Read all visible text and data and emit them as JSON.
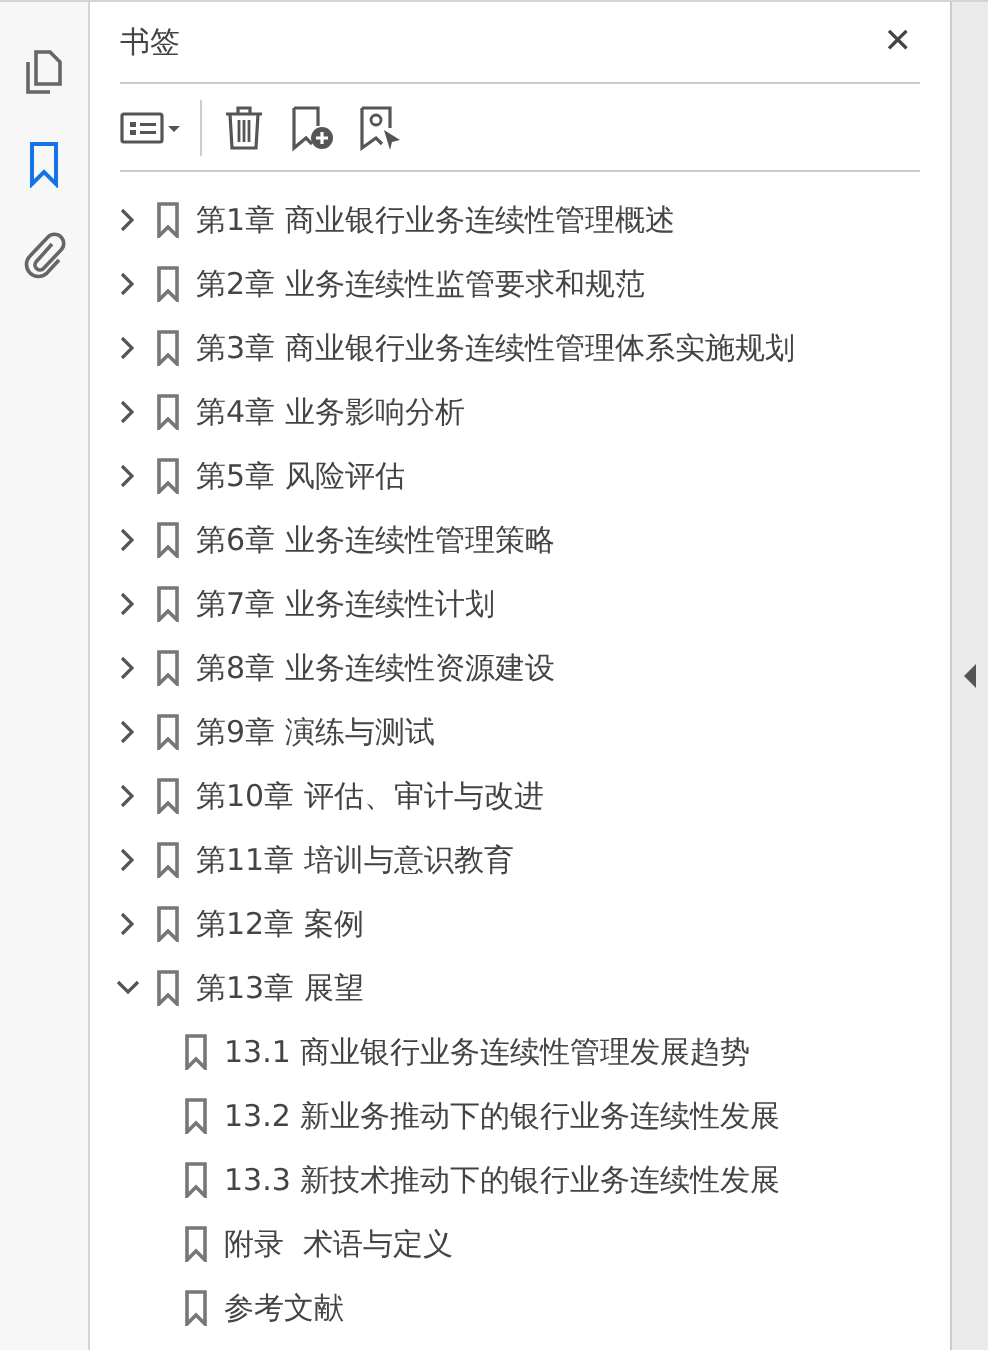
{
  "rail": [
    {
      "kind": "pages",
      "selected": false
    },
    {
      "kind": "bookmarks",
      "selected": true
    },
    {
      "kind": "attachments",
      "selected": false
    }
  ],
  "panel": {
    "title": "书签",
    "close": "✕"
  },
  "bookmarks": [
    {
      "label": "第1章 商业银行业务连续性管理概述",
      "expanded": false
    },
    {
      "label": "第2章 业务连续性监管要求和规范",
      "expanded": false
    },
    {
      "label": "第3章 商业银行业务连续性管理体系实施规划",
      "expanded": false
    },
    {
      "label": "第4章 业务影响分析",
      "expanded": false
    },
    {
      "label": "第5章 风险评估",
      "expanded": false
    },
    {
      "label": "第6章 业务连续性管理策略",
      "expanded": false
    },
    {
      "label": "第7章 业务连续性计划",
      "expanded": false
    },
    {
      "label": "第8章 业务连续性资源建设",
      "expanded": false
    },
    {
      "label": "第9章 演练与测试",
      "expanded": false
    },
    {
      "label": "第10章 评估、审计与改进",
      "expanded": false
    },
    {
      "label": "第11章 培训与意识教育",
      "expanded": false
    },
    {
      "label": "第12章 案例",
      "expanded": false
    },
    {
      "label": "第13章 展望",
      "expanded": true,
      "children": [
        {
          "label": "13.1 商业银行业务连续性管理发展趋势"
        },
        {
          "label": "13.2 新业务推动下的银行业务连续性发展"
        },
        {
          "label": "13.3 新技术推动下的银行业务连续性发展"
        },
        {
          "label": "附录  术语与定义"
        },
        {
          "label": "参考文献"
        }
      ]
    }
  ]
}
